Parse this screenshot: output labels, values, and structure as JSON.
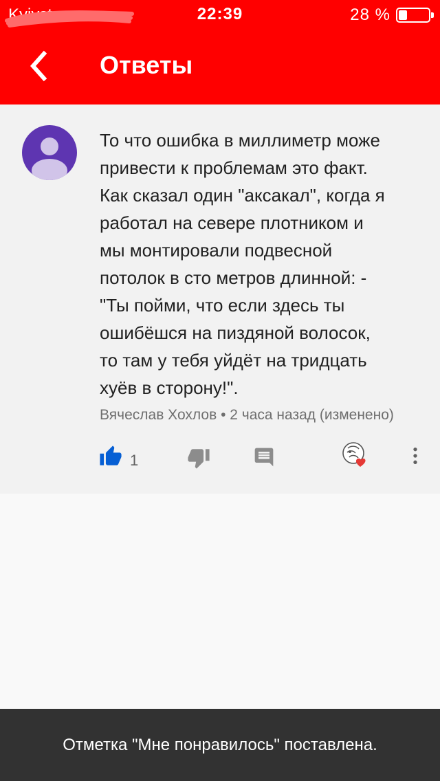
{
  "status_bar": {
    "carrier": "Kyivstar",
    "time": "22:39",
    "battery_percent": "28 %",
    "battery_level": 0.28
  },
  "app_bar": {
    "title": "Ответы",
    "back_icon": "chevron-left-icon"
  },
  "comment": {
    "avatar_icon": "person-icon",
    "avatar_color": "#5e35b1",
    "lines": [
      "То что ошибка в миллиметр може",
      "привести к проблемам это факт.",
      "Как сказал один \"аксакал\", когда я",
      "работал на севере плотником и",
      "мы монтировали подвесной",
      "потолок в сто метров длинной: -",
      "\"Ты пойми, что если здесь ты",
      "ошибёшся на пиздяной волосок,",
      "то там у тебя уйдёт на тридцать",
      "хуёв в сторону!\"."
    ],
    "author": "Вячеслав Хохлов",
    "separator": " • ",
    "time_ago": "2 часа назад (изменено)",
    "likes": "1",
    "like_active": true,
    "accent_color": "#065fd4"
  },
  "toast": {
    "message": "Отметка \"Мне понравилось\" поставлена."
  }
}
